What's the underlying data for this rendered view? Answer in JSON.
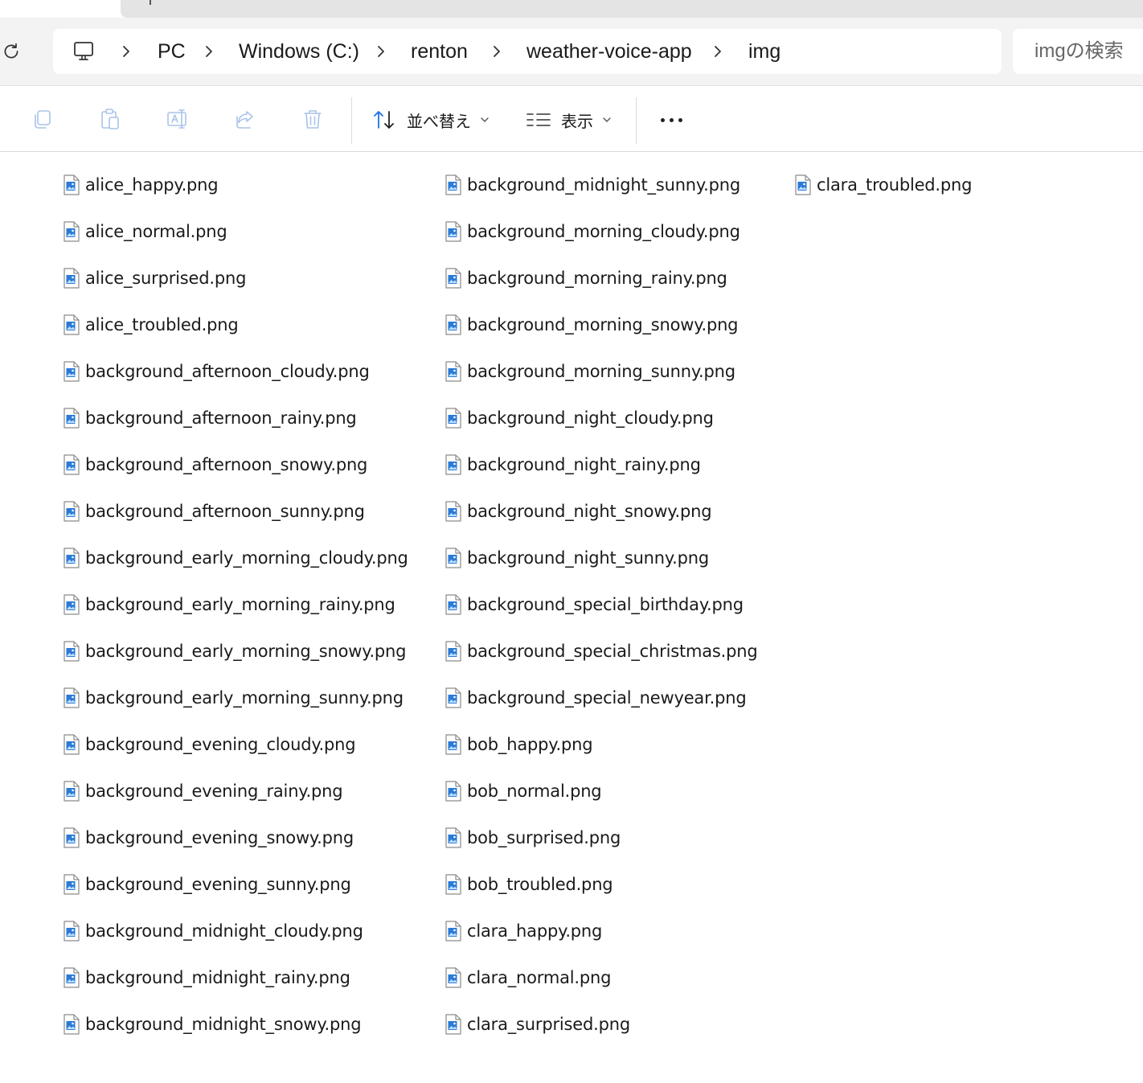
{
  "breadcrumb": {
    "items": [
      "PC",
      "Windows (C:)",
      "renton",
      "weather-voice-app",
      "img"
    ]
  },
  "search": {
    "placeholder": "imgの検索"
  },
  "commandbar": {
    "sort_label": "並べ替え",
    "view_label": "表示"
  },
  "files": {
    "columns": [
      [
        "alice_happy.png",
        "alice_normal.png",
        "alice_surprised.png",
        "alice_troubled.png",
        "background_afternoon_cloudy.png",
        "background_afternoon_rainy.png",
        "background_afternoon_snowy.png",
        "background_afternoon_sunny.png",
        "background_early_morning_cloudy.png",
        "background_early_morning_rainy.png",
        "background_early_morning_snowy.png",
        "background_early_morning_sunny.png",
        "background_evening_cloudy.png",
        "background_evening_rainy.png",
        "background_evening_snowy.png",
        "background_evening_sunny.png",
        "background_midnight_cloudy.png",
        "background_midnight_rainy.png",
        "background_midnight_snowy.png"
      ],
      [
        "background_midnight_sunny.png",
        "background_morning_cloudy.png",
        "background_morning_rainy.png",
        "background_morning_snowy.png",
        "background_morning_sunny.png",
        "background_night_cloudy.png",
        "background_night_rainy.png",
        "background_night_snowy.png",
        "background_night_sunny.png",
        "background_special_birthday.png",
        "background_special_christmas.png",
        "background_special_newyear.png",
        "bob_happy.png",
        "bob_normal.png",
        "bob_surprised.png",
        "bob_troubled.png",
        "clara_happy.png",
        "clara_normal.png",
        "clara_surprised.png"
      ],
      [
        "clara_troubled.png"
      ]
    ]
  },
  "colors": {
    "accent": "#1a73e8",
    "icon_blue": "#2b7bd6"
  }
}
